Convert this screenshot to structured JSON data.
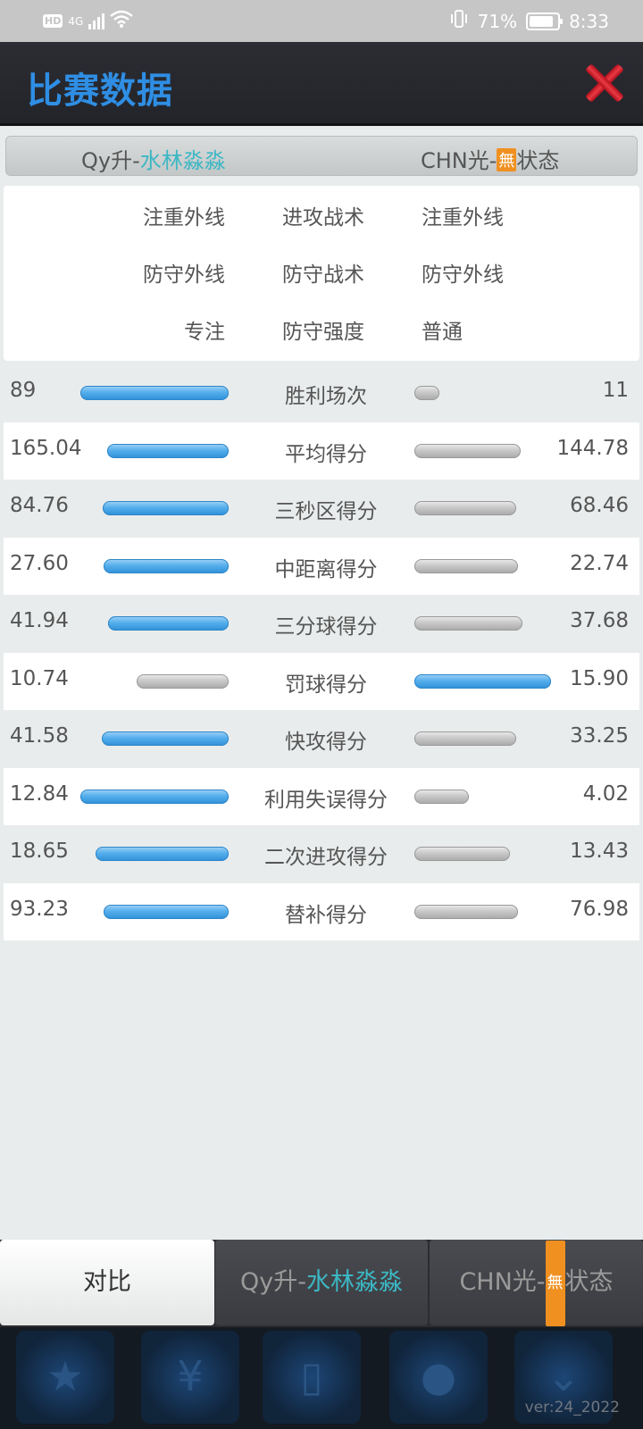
{
  "status_bar": {
    "hd": "HD",
    "network": "4G",
    "battery": "71%",
    "time": "8:33"
  },
  "header": {
    "title": "比赛数据"
  },
  "teams": {
    "left_prefix": "Qy升-",
    "left_suffix": "水林淼淼",
    "right_prefix": "CHN光-",
    "right_badge": "無",
    "right_suffix": "状态"
  },
  "tactics": [
    {
      "left": "注重外线",
      "label": "进攻战术",
      "right": "注重外线"
    },
    {
      "left": "防守外线",
      "label": "防守战术",
      "right": "防守外线"
    },
    {
      "left": "专注",
      "label": "防守强度",
      "right": "普通"
    }
  ],
  "stats": [
    {
      "label": "胜利场次",
      "left": "89",
      "right": "11",
      "left_fraction": 0.89,
      "right_fraction": 0.11,
      "left_color": "blue",
      "right_color": "gray"
    },
    {
      "label": "平均得分",
      "left": "165.04",
      "right": "144.78",
      "left_fraction": 0.533,
      "right_fraction": 0.467,
      "left_color": "blue",
      "right_color": "gray"
    },
    {
      "label": "三秒区得分",
      "left": "84.76",
      "right": "68.46",
      "left_fraction": 0.553,
      "right_fraction": 0.447,
      "left_color": "blue",
      "right_color": "gray"
    },
    {
      "label": "中距离得分",
      "left": "27.60",
      "right": "22.74",
      "left_fraction": 0.548,
      "right_fraction": 0.452,
      "left_color": "blue",
      "right_color": "gray"
    },
    {
      "label": "三分球得分",
      "left": "41.94",
      "right": "37.68",
      "left_fraction": 0.527,
      "right_fraction": 0.473,
      "left_color": "blue",
      "right_color": "gray"
    },
    {
      "label": "罚球得分",
      "left": "10.74",
      "right": "15.90",
      "left_fraction": 0.403,
      "right_fraction": 0.597,
      "left_color": "gray",
      "right_color": "blue"
    },
    {
      "label": "快攻得分",
      "left": "41.58",
      "right": "33.25",
      "left_fraction": 0.556,
      "right_fraction": 0.444,
      "left_color": "blue",
      "right_color": "gray"
    },
    {
      "label": "利用失误得分",
      "left": "12.84",
      "right": "4.02",
      "left_fraction": 0.762,
      "right_fraction": 0.238,
      "left_color": "blue",
      "right_color": "gray"
    },
    {
      "label": "二次进攻得分",
      "left": "18.65",
      "right": "13.43",
      "left_fraction": 0.581,
      "right_fraction": 0.419,
      "left_color": "blue",
      "right_color": "gray"
    },
    {
      "label": "替补得分",
      "left": "93.23",
      "right": "76.98",
      "left_fraction": 0.548,
      "right_fraction": 0.452,
      "left_color": "blue",
      "right_color": "gray"
    }
  ],
  "tabs": {
    "compare": "对比",
    "left_prefix": "Qy升-",
    "left_suffix": "水林淼淼",
    "right_prefix": "CHN光-",
    "right_badge": "無",
    "right_suffix": "状态"
  },
  "bottom_nav": {
    "icons": [
      "star-icon",
      "yen-icon",
      "player-card-icon",
      "chat-icon",
      "chevron-down-icon"
    ],
    "version": "ver:24_2022"
  }
}
